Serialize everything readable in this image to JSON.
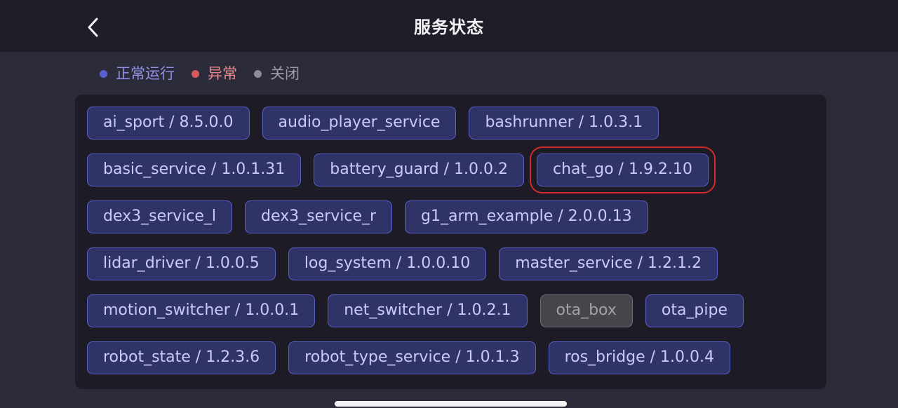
{
  "header": {
    "title": "服务状态",
    "back_icon": "chevron-left-icon"
  },
  "legend": [
    {
      "label": "正常运行",
      "color": "#5a5fcf"
    },
    {
      "label": "异常",
      "color": "#d85a5e"
    },
    {
      "label": "关闭",
      "color": "#8d8c96"
    }
  ],
  "services": [
    {
      "label": "ai_sport / 8.5.0.0",
      "status": "normal"
    },
    {
      "label": "audio_player_service",
      "status": "normal"
    },
    {
      "label": "bashrunner / 1.0.3.1",
      "status": "normal"
    },
    {
      "label": "basic_service / 1.0.1.31",
      "status": "normal"
    },
    {
      "label": "battery_guard / 1.0.0.2",
      "status": "normal"
    },
    {
      "label": "chat_go / 1.9.2.10",
      "status": "normal",
      "highlighted": true
    },
    {
      "label": "dex3_service_l",
      "status": "normal"
    },
    {
      "label": "dex3_service_r",
      "status": "normal"
    },
    {
      "label": "g1_arm_example / 2.0.0.13",
      "status": "normal"
    },
    {
      "label": "lidar_driver / 1.0.0.5",
      "status": "normal"
    },
    {
      "label": "log_system / 1.0.0.10",
      "status": "normal"
    },
    {
      "label": "master_service / 1.2.1.2",
      "status": "normal"
    },
    {
      "label": "motion_switcher / 1.0.0.1",
      "status": "normal"
    },
    {
      "label": "net_switcher / 1.0.2.1",
      "status": "normal"
    },
    {
      "label": "ota_box",
      "status": "off"
    },
    {
      "label": "ota_pipe",
      "status": "normal"
    },
    {
      "label": "robot_state / 1.2.3.6",
      "status": "normal"
    },
    {
      "label": "robot_type_service / 1.0.1.3",
      "status": "normal"
    },
    {
      "label": "ros_bridge / 1.0.0.4",
      "status": "normal"
    }
  ],
  "colors": {
    "normal_chip": "#2f3368",
    "off_chip": "#46454a",
    "highlight": "#d12b2b"
  }
}
